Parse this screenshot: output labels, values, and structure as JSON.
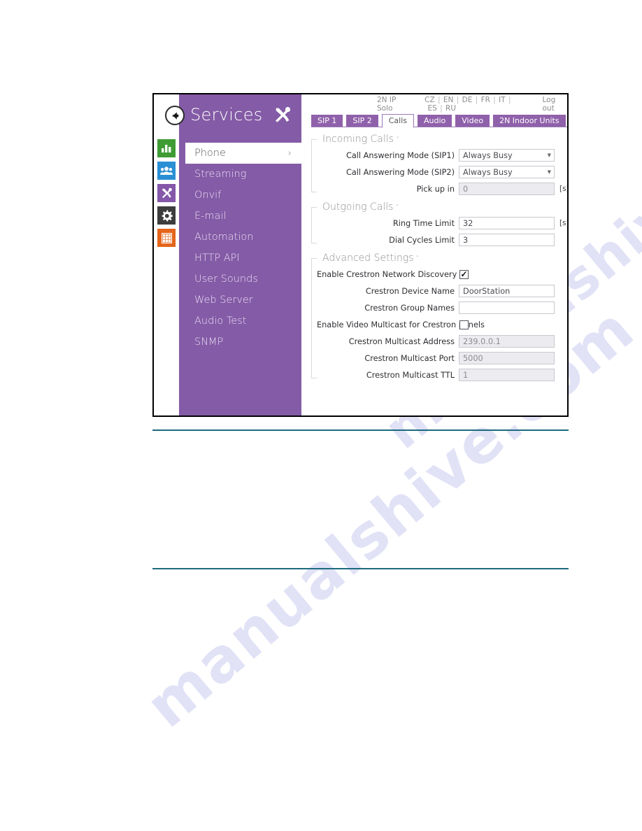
{
  "window": {
    "back_button": "back-arrow",
    "panel_title": "Services",
    "panel_icon": "tools-icon"
  },
  "rail": {
    "items": [
      {
        "name": "status-icon",
        "glyph": "bar-chart-icon",
        "color": "#3f9c35"
      },
      {
        "name": "directory-icon",
        "glyph": "users-icon",
        "color": "#2a8fd4"
      },
      {
        "name": "services-icon",
        "glyph": "tools-icon",
        "color": "#8457a8"
      },
      {
        "name": "system-icon",
        "glyph": "gear-icon",
        "color": "#3d3d3d"
      },
      {
        "name": "hardware-icon",
        "glyph": "grid-icon",
        "color": "#e4651b"
      }
    ]
  },
  "sidebar": {
    "items": [
      {
        "label": "Phone",
        "active": true,
        "chevron": "›"
      },
      {
        "label": "Streaming",
        "active": false
      },
      {
        "label": "Onvif",
        "active": false
      },
      {
        "label": "E-mail",
        "active": false
      },
      {
        "label": "Automation",
        "active": false
      },
      {
        "label": "HTTP API",
        "active": false
      },
      {
        "label": "User Sounds",
        "active": false
      },
      {
        "label": "Web Server",
        "active": false
      },
      {
        "label": "Audio Test",
        "active": false
      },
      {
        "label": "SNMP",
        "active": false
      }
    ]
  },
  "topbar": {
    "model": "2N IP Solo",
    "languages": [
      "CZ",
      "EN",
      "DE",
      "FR",
      "IT",
      "ES",
      "RU"
    ],
    "lang_separator": "|",
    "logout": "Log out"
  },
  "tabs": [
    {
      "label": "SIP 1",
      "active": false
    },
    {
      "label": "SIP 2",
      "active": false
    },
    {
      "label": "Calls",
      "active": true
    },
    {
      "label": "Audio",
      "active": false
    },
    {
      "label": "Video",
      "active": false
    },
    {
      "label": "2N Indoor Units",
      "active": false
    }
  ],
  "sections": [
    {
      "title": "Incoming Calls",
      "caret": "ˇ",
      "rows": [
        {
          "label": "Call Answering Mode (SIP1)",
          "type": "select",
          "value": "Always Busy",
          "disabled": false,
          "unit": ""
        },
        {
          "label": "Call Answering Mode (SIP2)",
          "type": "select",
          "value": "Always Busy",
          "disabled": false,
          "unit": ""
        },
        {
          "label": "Pick up in",
          "type": "text",
          "value": "0",
          "disabled": true,
          "unit": "[s]"
        }
      ]
    },
    {
      "title": "Outgoing Calls",
      "caret": "ˇ",
      "rows": [
        {
          "label": "Ring Time Limit",
          "type": "text",
          "value": "32",
          "disabled": false,
          "unit": "[s]"
        },
        {
          "label": "Dial Cycles Limit",
          "type": "text",
          "value": "3",
          "disabled": false,
          "unit": ""
        }
      ]
    },
    {
      "title": "Advanced Settings",
      "caret": "ˇ",
      "rows": [
        {
          "label": "Enable Crestron Network Discovery",
          "type": "checkbox",
          "value": "",
          "checked": true,
          "disabled": false,
          "unit": ""
        },
        {
          "label": "Crestron Device Name",
          "type": "text",
          "value": "DoorStation",
          "disabled": false,
          "unit": ""
        },
        {
          "label": "Crestron Group Names",
          "type": "text",
          "value": "",
          "disabled": false,
          "unit": ""
        },
        {
          "label": "Enable Video Multicast for Crestron panels",
          "type": "checkbox",
          "value": "",
          "checked": false,
          "disabled": false,
          "unit": ""
        },
        {
          "label": "Crestron Multicast Address",
          "type": "text",
          "value": "239.0.0.1",
          "disabled": true,
          "unit": ""
        },
        {
          "label": "Crestron Multicast Port",
          "type": "text",
          "value": "5000",
          "disabled": true,
          "unit": ""
        },
        {
          "label": "Crestron Multicast TTL",
          "type": "text",
          "value": "1",
          "disabled": true,
          "unit": ""
        }
      ]
    }
  ],
  "watermark": {
    "line1": "manualshive.com",
    "line2": "manualshive.com"
  },
  "colors": {
    "panel_purple": "#845ba6",
    "tab_purple": "#9061ab",
    "rule_teal": "#1b6b7d",
    "accent_green": "#3f9c35",
    "accent_blue": "#2a8fd4",
    "accent_orange": "#e4651b"
  }
}
